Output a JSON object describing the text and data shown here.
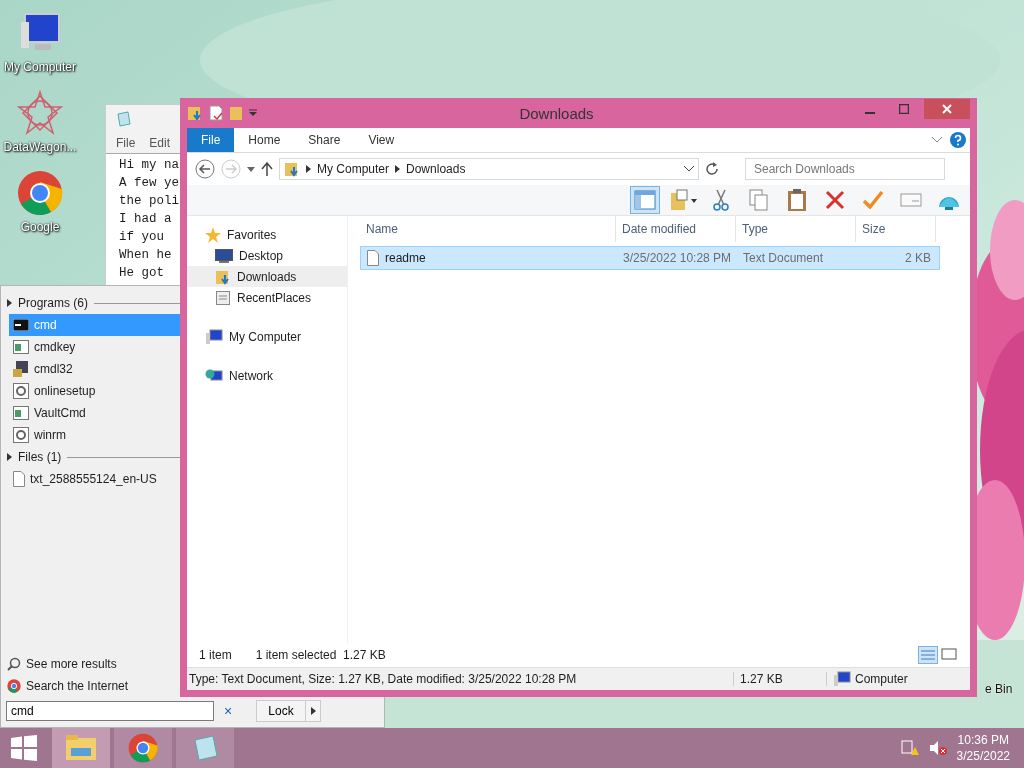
{
  "desktop": {
    "icons": [
      {
        "kind": "computer",
        "label": "My Computer"
      },
      {
        "kind": "star",
        "label": "DataWagon..."
      },
      {
        "kind": "chrome",
        "label": "Google"
      }
    ],
    "recycle_bin": "e Bin"
  },
  "notepad": {
    "menu": [
      "File",
      "Edit"
    ],
    "lines": [
      "Hi my na",
      "A few ye",
      "the poli",
      "I had a",
      "if you",
      "When he",
      "He got"
    ]
  },
  "start_menu": {
    "groups": [
      {
        "title": "Programs (6)",
        "items": [
          {
            "kind": "console",
            "label": "cmd",
            "selected": true
          },
          {
            "kind": "app",
            "label": "cmdkey",
            "selected": false
          },
          {
            "kind": "installer",
            "label": "cmdl32",
            "selected": false
          },
          {
            "kind": "setup",
            "label": "onlinesetup",
            "selected": false
          },
          {
            "kind": "app",
            "label": "VaultCmd",
            "selected": false
          },
          {
            "kind": "setup",
            "label": "winrm",
            "selected": false
          }
        ]
      },
      {
        "title": "Files (1)",
        "items": [
          {
            "kind": "file",
            "label": "txt_2588555124_en-US",
            "selected": false
          }
        ]
      }
    ],
    "links": [
      {
        "kind": "search",
        "label": "See more results"
      },
      {
        "kind": "chrome",
        "label": "Search the Internet"
      }
    ],
    "search": {
      "value": "cmd"
    },
    "clear": "×",
    "power": "Lock"
  },
  "explorer": {
    "title": "Downloads",
    "ribbon_tabs": [
      {
        "label": "File",
        "selected": true
      },
      {
        "label": "Home",
        "selected": false
      },
      {
        "label": "Share",
        "selected": false
      },
      {
        "label": "View",
        "selected": false
      }
    ],
    "address": [
      "My Computer",
      "Downloads"
    ],
    "search": {
      "placeholder": "Search Downloads"
    },
    "nav": [
      {
        "kind": "star",
        "label": "Favorites",
        "selected": false,
        "children": [
          {
            "kind": "desktop",
            "label": "Desktop",
            "selected": false
          },
          {
            "kind": "downloads",
            "label": "Downloads",
            "selected": true
          },
          {
            "kind": "recent",
            "label": "RecentPlaces",
            "selected": false
          }
        ]
      },
      {
        "kind": "computer",
        "label": "My Computer",
        "selected": false
      },
      {
        "kind": "network",
        "label": "Network",
        "selected": false
      }
    ],
    "columns": [
      "Name",
      "Date modified",
      "Type",
      "Size"
    ],
    "rows": [
      {
        "name": "readme",
        "date": "3/25/2022 10:28 PM",
        "type": "Text Document",
        "size": "2 KB",
        "selected": true
      }
    ],
    "status": {
      "count": "1 item",
      "selection": "1 item selected  1.27 KB"
    },
    "details": {
      "text": "Type: Text Document, Size: 1.27 KB, Date modified: 3/25/2022 10:28 PM",
      "size": "1.27 KB",
      "location": "Computer"
    }
  },
  "taskbar": {
    "apps": [
      {
        "kind": "explorer",
        "selected": true
      },
      {
        "kind": "chrome",
        "selected": false
      },
      {
        "kind": "notepad",
        "selected": false
      }
    ],
    "time": "10:36 PM",
    "date": "3/25/2022"
  }
}
